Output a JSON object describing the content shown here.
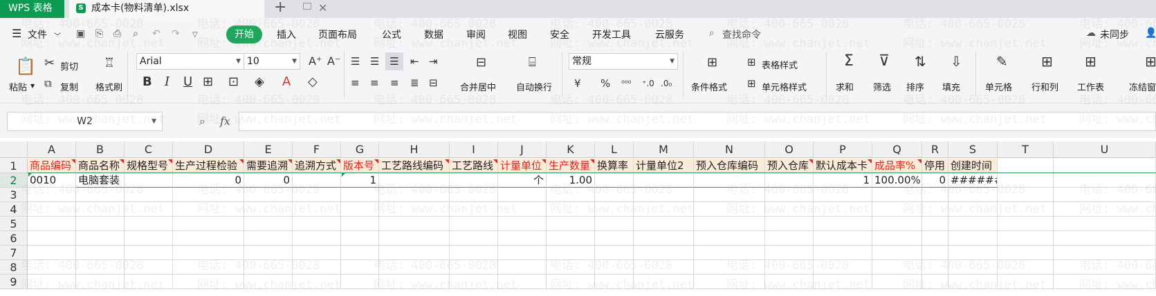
{
  "titlebar": {
    "app": "WPS 表格",
    "doc_name": "成本卡(物料清单).xlsx"
  },
  "menu": {
    "file": "文件",
    "tabs": [
      "开始",
      "插入",
      "页面布局",
      "公式",
      "数据",
      "审阅",
      "视图",
      "安全",
      "开发工具",
      "云服务"
    ],
    "search": "查找命令",
    "sync": "未同步"
  },
  "ribbon": {
    "paste": "粘贴",
    "cut": "剪切",
    "copy": "复制",
    "format_painter": "格式刷",
    "font_name": "Arial",
    "font_size": "10",
    "merge_center": "合并居中",
    "wrap_text": "自动换行",
    "number_format": "常规",
    "conditional_format": "条件格式",
    "table_style": "表格样式",
    "cell_style": "单元格样式",
    "sum": "求和",
    "filter": "筛选",
    "sort": "排序",
    "fill": "填充",
    "cell": "单元格",
    "row_col": "行和列",
    "worksheet": "工作表",
    "freeze": "冻结窗"
  },
  "formula_bar": {
    "name_box": "W2",
    "fx": "fx",
    "formula": ""
  },
  "watermark": {
    "phone": "电话: 400-665-0028",
    "site": "网址: www.chanjet.net"
  },
  "grid": {
    "columns": [
      "A",
      "B",
      "C",
      "D",
      "E",
      "F",
      "G",
      "H",
      "I",
      "J",
      "K",
      "L",
      "M",
      "N",
      "O",
      "P",
      "Q",
      "R",
      "S",
      "T",
      "U"
    ],
    "rows": [
      "1",
      "2",
      "3",
      "4",
      "5",
      "6",
      "7",
      "8",
      "9"
    ],
    "header_row": [
      "商品编码",
      "商品名称",
      "规格型号",
      "生产过程检验",
      "需要追溯",
      "追溯方式",
      "版本号",
      "工艺路线编码",
      "工艺路线",
      "计量单位",
      "生产数量",
      "换算率",
      "计量单位2",
      "预入仓库编码",
      "预入仓库",
      "默认成本卡",
      "成品率%",
      "停用",
      "创建时间",
      "",
      ""
    ],
    "data_row": [
      "0010",
      "电脑套装",
      "",
      "0",
      "0",
      "",
      "1",
      "",
      "",
      "个",
      "1.00",
      "",
      "",
      "",
      "",
      "1",
      "100.00%",
      "0",
      "#######",
      "",
      ""
    ]
  },
  "colors": {
    "accent": "#1fa55c",
    "required_header": "#e0221e",
    "header_fill": "#fdebd9"
  }
}
